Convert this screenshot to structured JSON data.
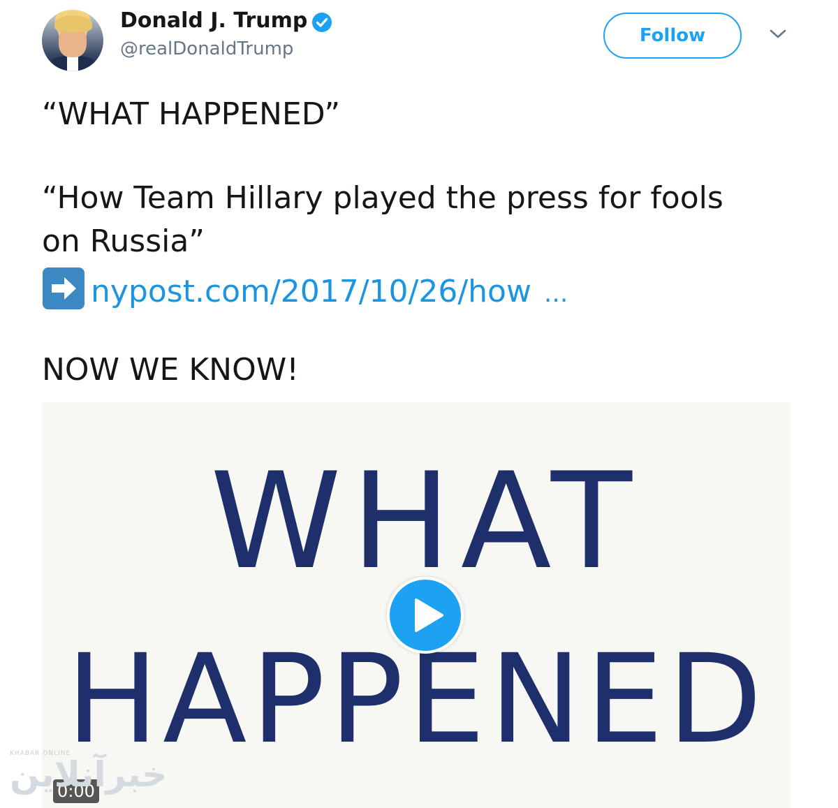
{
  "user": {
    "display_name": "Donald J. Trump",
    "handle": "@realDonaldTrump",
    "verified": true
  },
  "actions": {
    "follow_label": "Follow",
    "more_icon": "chevron-down-icon"
  },
  "tweet": {
    "line1": "“WHAT HAPPENED”",
    "line2": "“How Team Hillary played the press for fools",
    "line3": "on Russia”",
    "link_icon": "right-arrow-emoji-icon",
    "link_text": "nypost.com/2017/10/26/how",
    "link_ellipsis": "...",
    "line5": "NOW WE KNOW!"
  },
  "media": {
    "book_title_line1": "WHAT",
    "book_title_line2": "HAPPENED",
    "play_icon": "play-icon",
    "timestamp": "0:00"
  },
  "watermark": {
    "top_text": "KHABAR ONLINE",
    "text": "خبرآنلاین"
  },
  "colors": {
    "accent": "#1da1f2",
    "link": "#1b95e0",
    "book_title": "#1e2f6b",
    "muted": "#657786"
  }
}
